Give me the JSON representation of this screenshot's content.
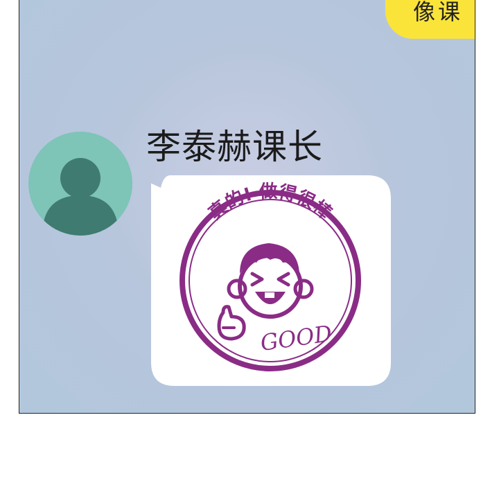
{
  "outgoing_message": {
    "text": "像课"
  },
  "contact": {
    "name": "李泰赫课长",
    "avatar_color": "#7ec4b7",
    "avatar_figure_color": "#3f7b70"
  },
  "sticker": {
    "top_text": "真的! 做得很棒",
    "bottom_text": "GOOD",
    "stamp_color": "#8a2c86"
  },
  "colors": {
    "chat_background": "#b2c7dc",
    "outgoing_bubble": "#fbe43a",
    "incoming_bubble": "#ffffff"
  }
}
